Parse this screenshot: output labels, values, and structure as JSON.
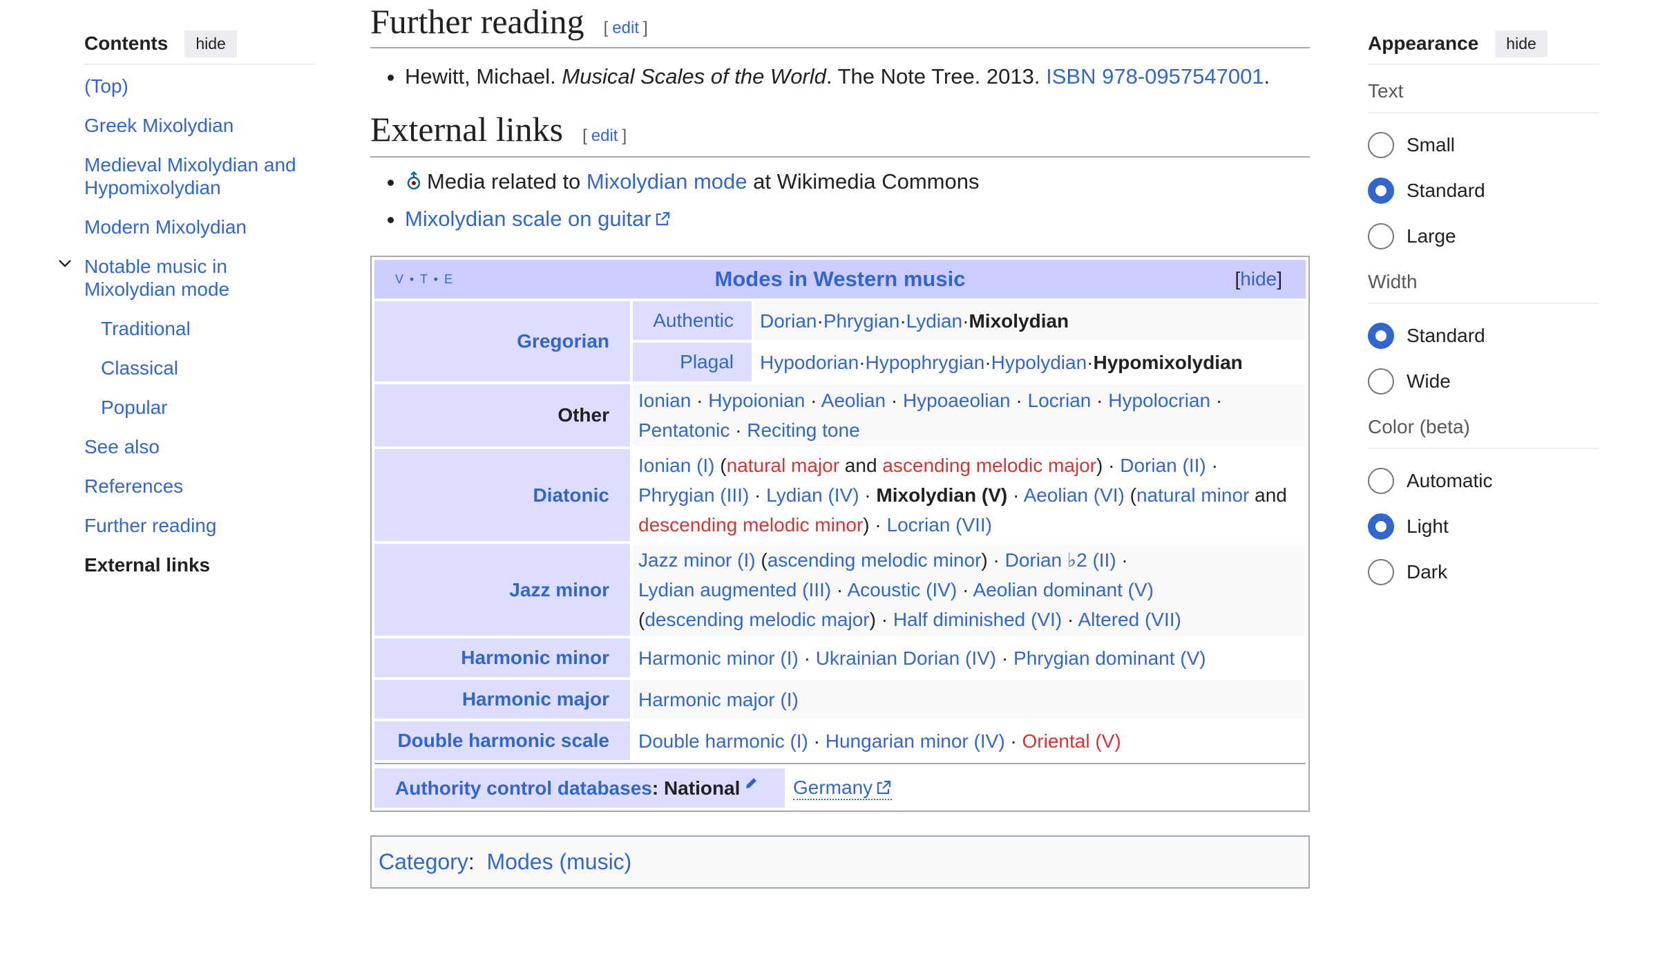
{
  "toc": {
    "title": "Contents",
    "hide_label": "hide",
    "items": [
      {
        "label": "(Top)"
      },
      {
        "label": "Greek Mixolydian"
      },
      {
        "label": "Medieval Mixolydian and Hypomixolydian"
      },
      {
        "label": "Modern Mixolydian"
      },
      {
        "label": "Notable music in Mixolydian mode"
      },
      {
        "label": "Traditional"
      },
      {
        "label": "Classical"
      },
      {
        "label": "Popular"
      },
      {
        "label": "See also"
      },
      {
        "label": "References"
      },
      {
        "label": "Further reading"
      },
      {
        "label": "External links"
      }
    ]
  },
  "further_reading": {
    "heading": "Further reading",
    "edit": "edit",
    "item": {
      "author": "Hewitt, Michael. ",
      "title": "Musical Scales of the World",
      "publisher": ". The Note Tree. 2013. ",
      "isbn": "ISBN 978-0957547001",
      "end": "."
    }
  },
  "external_links": {
    "heading": "External links",
    "edit": "edit",
    "commons_pre": "Media related to ",
    "commons_link": "Mixolydian mode",
    "commons_post": " at Wikimedia Commons",
    "guitar_link": "Mixolydian scale on guitar"
  },
  "navbox": {
    "vte": "V • T • E",
    "title": "Modes in Western music",
    "hide": "hide",
    "gregorian": {
      "group": "Gregorian",
      "authentic_label": "Authentic",
      "authentic": [
        "Dorian",
        "Phrygian",
        "Lydian"
      ],
      "authentic_bold": "Mixolydian",
      "plagal_label": "Plagal",
      "plagal": [
        "Hypodorian",
        "Hypophrygian",
        "Hypolydian"
      ],
      "plagal_bold": "Hypomixolydian"
    },
    "other": {
      "group": "Other",
      "items": [
        "Ionian",
        "Hypoionian",
        "Aeolian",
        "Hypoaeolian",
        "Locrian",
        "Hypolocrian",
        "Pentatonic",
        "Reciting tone"
      ]
    },
    "diatonic": {
      "group": "Diatonic",
      "ionian": "Ionian (I)",
      "natural_major": "natural major",
      "and1": " and ",
      "ascending_melodic_major": "ascending melodic major",
      "dorian": "Dorian (II)",
      "phrygian": "Phrygian (III)",
      "lydian": "Lydian (IV)",
      "mixolydian": "Mixolydian (V)",
      "aeolian": "Aeolian (VI)",
      "natural_minor": "natural minor",
      "and2": " and",
      "descending_melodic_minor": "descending melodic minor",
      "locrian": "Locrian (VII)"
    },
    "jazz_minor": {
      "group": "Jazz minor",
      "jazz": "Jazz minor (I)",
      "ascending_melodic_minor": "ascending melodic minor",
      "dorian_b2": "Dorian ♭2 (II)",
      "lydian_aug": "Lydian augmented (III)",
      "acoustic": "Acoustic (IV)",
      "aeolian_dom": "Aeolian dominant (V)",
      "descending_melodic_major": "descending melodic major",
      "half_dim": "Half diminished (VI)",
      "altered": "Altered (VII)"
    },
    "harmonic_minor": {
      "group": "Harmonic minor",
      "items": [
        "Harmonic minor (I)",
        "Ukrainian Dorian (IV)",
        "Phrygian dominant (V)"
      ]
    },
    "harmonic_major": {
      "group": "Harmonic major",
      "items": [
        "Harmonic major (I)"
      ]
    },
    "double_harmonic": {
      "group": "Double harmonic scale",
      "items": [
        "Double harmonic (I)",
        "Hungarian minor (IV)"
      ],
      "red_item": "Oriental (V)"
    },
    "authority": {
      "link": "Authority control databases",
      "national": ": National",
      "germany": "Germany"
    }
  },
  "category": {
    "label": "Category",
    "colon": ":",
    "item": "Modes (music)"
  },
  "appearance": {
    "title": "Appearance",
    "hide_label": "hide",
    "text_label": "Text",
    "text_options": [
      "Small",
      "Standard",
      "Large"
    ],
    "text_selected": "Standard",
    "width_label": "Width",
    "width_options": [
      "Standard",
      "Wide"
    ],
    "width_selected": "Standard",
    "color_label": "Color (beta)",
    "color_options": [
      "Automatic",
      "Light",
      "Dark"
    ],
    "color_selected": "Light"
  },
  "colors": {
    "link": "#3366cc",
    "redlink": "#d73333",
    "navbox_title_bg": "#ccccff",
    "navbox_group_bg": "#ddddff"
  }
}
